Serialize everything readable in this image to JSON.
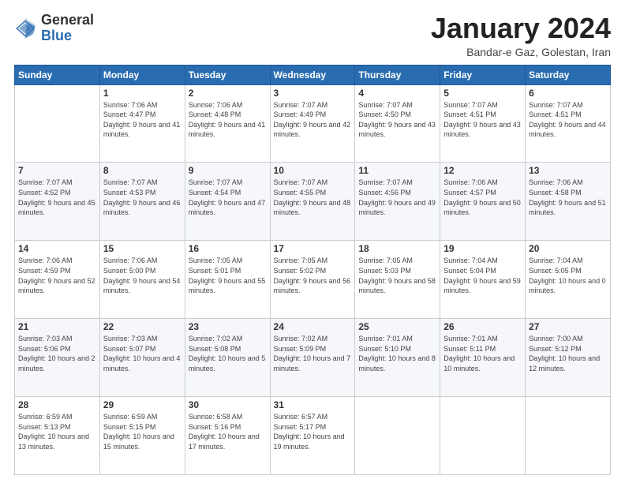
{
  "logo": {
    "general": "General",
    "blue": "Blue"
  },
  "header": {
    "title": "January 2024",
    "subtitle": "Bandar-e Gaz, Golestan, Iran"
  },
  "weekdays": [
    "Sunday",
    "Monday",
    "Tuesday",
    "Wednesday",
    "Thursday",
    "Friday",
    "Saturday"
  ],
  "weeks": [
    [
      {
        "day": null,
        "info": null
      },
      {
        "day": "1",
        "sunrise": "7:06 AM",
        "sunset": "4:47 PM",
        "daylight": "9 hours and 41 minutes."
      },
      {
        "day": "2",
        "sunrise": "7:06 AM",
        "sunset": "4:48 PM",
        "daylight": "9 hours and 41 minutes."
      },
      {
        "day": "3",
        "sunrise": "7:07 AM",
        "sunset": "4:49 PM",
        "daylight": "9 hours and 42 minutes."
      },
      {
        "day": "4",
        "sunrise": "7:07 AM",
        "sunset": "4:50 PM",
        "daylight": "9 hours and 43 minutes."
      },
      {
        "day": "5",
        "sunrise": "7:07 AM",
        "sunset": "4:51 PM",
        "daylight": "9 hours and 43 minutes."
      },
      {
        "day": "6",
        "sunrise": "7:07 AM",
        "sunset": "4:51 PM",
        "daylight": "9 hours and 44 minutes."
      }
    ],
    [
      {
        "day": "7",
        "sunrise": "7:07 AM",
        "sunset": "4:52 PM",
        "daylight": "9 hours and 45 minutes."
      },
      {
        "day": "8",
        "sunrise": "7:07 AM",
        "sunset": "4:53 PM",
        "daylight": "9 hours and 46 minutes."
      },
      {
        "day": "9",
        "sunrise": "7:07 AM",
        "sunset": "4:54 PM",
        "daylight": "9 hours and 47 minutes."
      },
      {
        "day": "10",
        "sunrise": "7:07 AM",
        "sunset": "4:55 PM",
        "daylight": "9 hours and 48 minutes."
      },
      {
        "day": "11",
        "sunrise": "7:07 AM",
        "sunset": "4:56 PM",
        "daylight": "9 hours and 49 minutes."
      },
      {
        "day": "12",
        "sunrise": "7:06 AM",
        "sunset": "4:57 PM",
        "daylight": "9 hours and 50 minutes."
      },
      {
        "day": "13",
        "sunrise": "7:06 AM",
        "sunset": "4:58 PM",
        "daylight": "9 hours and 51 minutes."
      }
    ],
    [
      {
        "day": "14",
        "sunrise": "7:06 AM",
        "sunset": "4:59 PM",
        "daylight": "9 hours and 52 minutes."
      },
      {
        "day": "15",
        "sunrise": "7:06 AM",
        "sunset": "5:00 PM",
        "daylight": "9 hours and 54 minutes."
      },
      {
        "day": "16",
        "sunrise": "7:05 AM",
        "sunset": "5:01 PM",
        "daylight": "9 hours and 55 minutes."
      },
      {
        "day": "17",
        "sunrise": "7:05 AM",
        "sunset": "5:02 PM",
        "daylight": "9 hours and 56 minutes."
      },
      {
        "day": "18",
        "sunrise": "7:05 AM",
        "sunset": "5:03 PM",
        "daylight": "9 hours and 58 minutes."
      },
      {
        "day": "19",
        "sunrise": "7:04 AM",
        "sunset": "5:04 PM",
        "daylight": "9 hours and 59 minutes."
      },
      {
        "day": "20",
        "sunrise": "7:04 AM",
        "sunset": "5:05 PM",
        "daylight": "10 hours and 0 minutes."
      }
    ],
    [
      {
        "day": "21",
        "sunrise": "7:03 AM",
        "sunset": "5:06 PM",
        "daylight": "10 hours and 2 minutes."
      },
      {
        "day": "22",
        "sunrise": "7:03 AM",
        "sunset": "5:07 PM",
        "daylight": "10 hours and 4 minutes."
      },
      {
        "day": "23",
        "sunrise": "7:02 AM",
        "sunset": "5:08 PM",
        "daylight": "10 hours and 5 minutes."
      },
      {
        "day": "24",
        "sunrise": "7:02 AM",
        "sunset": "5:09 PM",
        "daylight": "10 hours and 7 minutes."
      },
      {
        "day": "25",
        "sunrise": "7:01 AM",
        "sunset": "5:10 PM",
        "daylight": "10 hours and 8 minutes."
      },
      {
        "day": "26",
        "sunrise": "7:01 AM",
        "sunset": "5:11 PM",
        "daylight": "10 hours and 10 minutes."
      },
      {
        "day": "27",
        "sunrise": "7:00 AM",
        "sunset": "5:12 PM",
        "daylight": "10 hours and 12 minutes."
      }
    ],
    [
      {
        "day": "28",
        "sunrise": "6:59 AM",
        "sunset": "5:13 PM",
        "daylight": "10 hours and 13 minutes."
      },
      {
        "day": "29",
        "sunrise": "6:59 AM",
        "sunset": "5:15 PM",
        "daylight": "10 hours and 15 minutes."
      },
      {
        "day": "30",
        "sunrise": "6:58 AM",
        "sunset": "5:16 PM",
        "daylight": "10 hours and 17 minutes."
      },
      {
        "day": "31",
        "sunrise": "6:57 AM",
        "sunset": "5:17 PM",
        "daylight": "10 hours and 19 minutes."
      },
      {
        "day": null,
        "info": null
      },
      {
        "day": null,
        "info": null
      },
      {
        "day": null,
        "info": null
      }
    ]
  ]
}
